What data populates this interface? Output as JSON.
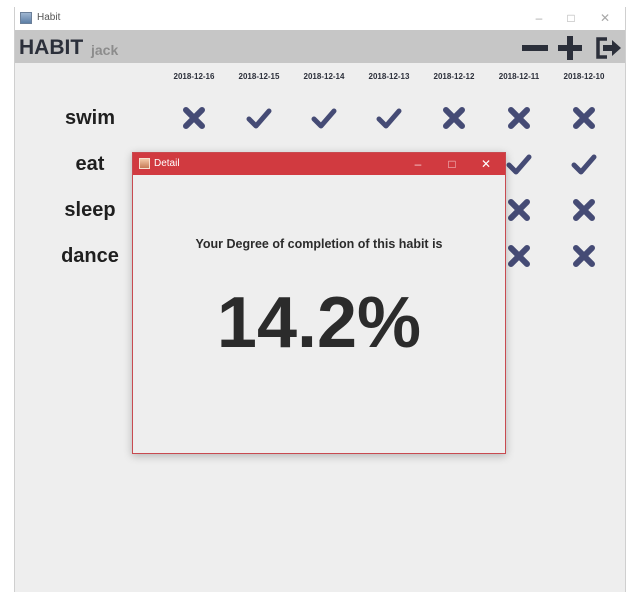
{
  "window": {
    "title": "Habit",
    "controls": {
      "minimize": "–",
      "maximize": "□",
      "close": "✕"
    }
  },
  "header": {
    "brand": "HABIT",
    "user": "jack",
    "icons": [
      "minus-icon",
      "plus-icon",
      "logout-icon"
    ]
  },
  "dates": [
    "2018-12-16",
    "2018-12-15",
    "2018-12-14",
    "2018-12-13",
    "2018-12-12",
    "2018-12-11",
    "2018-12-10"
  ],
  "habits": [
    {
      "name": "swim",
      "marks": [
        "cross",
        "check",
        "check",
        "check",
        "cross",
        "cross",
        "cross"
      ]
    },
    {
      "name": "eat",
      "marks": [
        "",
        "",
        "",
        "",
        "",
        "check",
        "check"
      ]
    },
    {
      "name": "sleep",
      "marks": [
        "",
        "",
        "",
        "",
        "",
        "cross",
        "cross"
      ]
    },
    {
      "name": "dance",
      "marks": [
        "",
        "",
        "",
        "",
        "",
        "cross",
        "cross"
      ]
    }
  ],
  "colors": {
    "mark": "#454b75",
    "dialog_title": "#d13a40",
    "header": "#c6c6c6"
  },
  "dialog": {
    "title": "Detail",
    "message": "Your Degree of completion of this habit is",
    "percent": "14.2%",
    "controls": {
      "minimize": "–",
      "maximize": "□",
      "close": "✕"
    }
  }
}
